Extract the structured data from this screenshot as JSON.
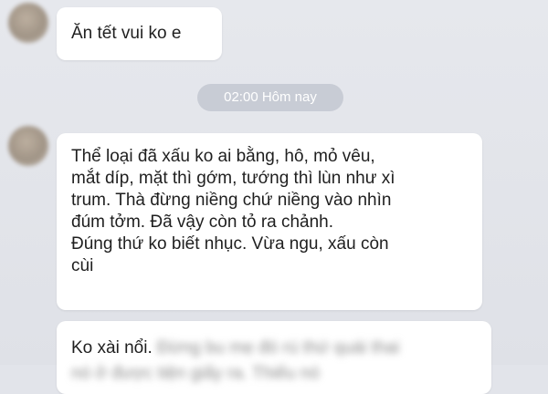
{
  "chat": {
    "messages": [
      {
        "text": "Ăn tết vui ko e"
      },
      {
        "lines": [
          "Thể loại đã xấu ko ai bằng, hô, mỏ vêu,",
          "mắt díp, mặt thì gớm, tướng thì lùn như xì",
          "trum. Thà đừng niềng chứ niềng vào nhìn",
          "đúm tởm. Đã vậy còn tỏ ra chảnh.",
          "Đúng thứ ko biết nhục. Vừa ngu, xấu còn",
          "cùi"
        ]
      },
      {
        "text": "Ko xài nổi.",
        "blurred_1": "Đừng bu mẹ đó rú thứ quái thai",
        "blurred_2": "nó ở được tiện giấy ra. Thiếu nó"
      }
    ],
    "timestamp": "02:00 Hôm nay"
  }
}
